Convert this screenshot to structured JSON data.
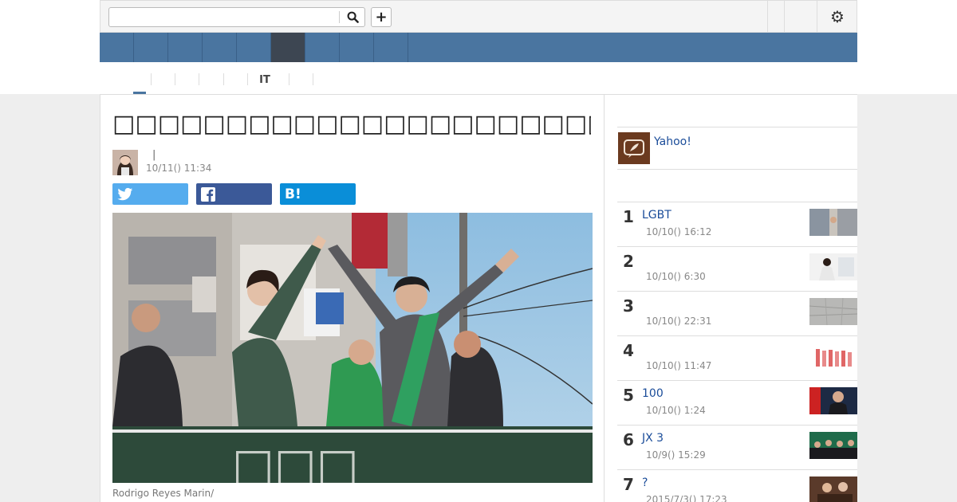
{
  "header": {
    "search_placeholder": "",
    "search_icon": "search-icon",
    "plus_label": "+",
    "settings_icon": "gear-icon"
  },
  "category_nav": {
    "items": [
      "",
      "",
      "",
      "",
      "",
      "IT",
      "",
      ""
    ],
    "active_index": 0
  },
  "article": {
    "title": "□□□□□□□□□□□□□□□□□□□□□□□□□□□□□□",
    "author_separator": "|",
    "published": "10/11() 11:34",
    "share": {
      "twitter_icon": "twitter-icon",
      "facebook_icon": "facebook-icon",
      "hatena_label": "B!"
    },
    "image_caption": "Rodrigo Reyes Marin/"
  },
  "sidebar": {
    "yahoo_label": "Yahoo!",
    "ranking": [
      {
        "rank": "1",
        "title": "LGBT",
        "time": "10/10() 16:12"
      },
      {
        "rank": "2",
        "title": "",
        "time": "10/10() 6:30"
      },
      {
        "rank": "3",
        "title": "",
        "time": "10/10() 22:31"
      },
      {
        "rank": "4",
        "title": "",
        "time": "10/10() 11:47"
      },
      {
        "rank": "5",
        "title": "100",
        "time": "10/10() 1:24"
      },
      {
        "rank": "6",
        "title": "JX 3",
        "time": "10/9() 15:29"
      },
      {
        "rank": "7",
        "title": "?",
        "time": "2015/7/3() 17:23"
      }
    ]
  },
  "colors": {
    "nav_blue": "#4a75a0",
    "nav_active": "#3d4652",
    "link_blue": "#1a4c99",
    "twitter": "#55acee",
    "facebook": "#3b5998",
    "hatena": "#0a8ed8"
  }
}
